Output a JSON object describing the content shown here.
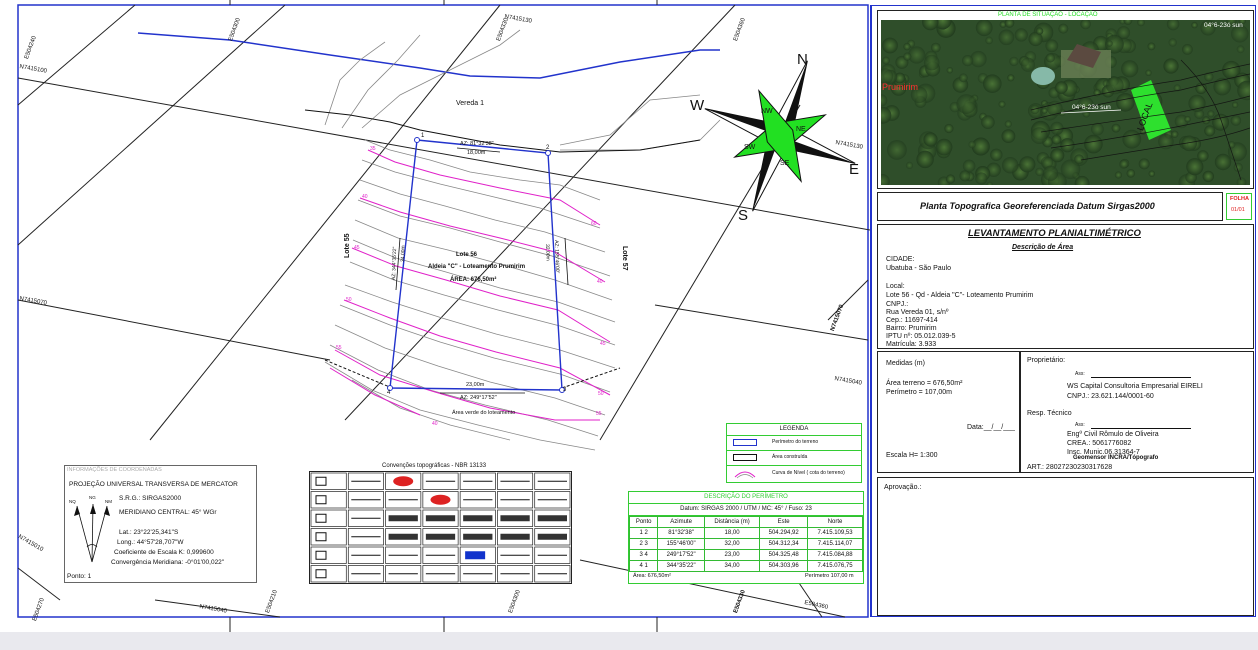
{
  "map": {
    "street_label": "Vereda 1",
    "lot_left": "Lote 55",
    "lot_right": "Lote 57",
    "lot_title": "Lote  56",
    "lot_subtitle": "Aldeia \"C\" - Loteamento Prumirim",
    "lot_area": "ÁREA: 676,50m²",
    "az_top": "AZ: 81°32'38\"",
    "dist_top": "18,00m",
    "dist_bottom": "23,00m",
    "az_bottom": "AZ: 249°17'52\"",
    "green_area_note": "Área verde do loteamento",
    "az_left": "AZ: 344°35'22\"",
    "dist_left": "34,00m",
    "az_right": "AZ: 155°46'00\"",
    "dist_right": "32,00m",
    "vertices": [
      "1",
      "2",
      "3",
      "4"
    ],
    "grid_labels": [
      "E504240",
      "E504270",
      "E504300",
      "E504330",
      "E504360",
      "N7415100",
      "N7415130",
      "N7415070",
      "N7415040",
      "N7415010",
      "E504210",
      "E504300",
      "E504330",
      "E504360",
      "N7415040",
      "N7415070",
      "N7415130",
      "N7415100"
    ],
    "contour_labels": [
      "35",
      "40",
      "45",
      "50",
      "55",
      "60",
      "40",
      "45",
      "50",
      "55",
      "40"
    ]
  },
  "compass": {
    "n": "N",
    "s": "S",
    "e": "E",
    "w": "W",
    "nw": "NW",
    "ne": "NE",
    "sw": "SW",
    "se": "SE"
  },
  "coords": {
    "header": "INFORMAÇÕES DE COORDENADAS",
    "projection": "PROJEÇÃO UNIVERSAL TRANSVERSA DE MERCATOR",
    "srg": "S.R.G.: SIRGAS2000",
    "meridian": "MERIDIANO CENTRAL: 45° WGr",
    "lat": "Lat.: 23°22'25,341\"S",
    "long": "Long.: 44°57'28,707\"W",
    "scale_k": "Coeficiente de Escala K: 0,999600",
    "convergence": "Convergência Meridiana: -0°01'00,022\"",
    "point": "Ponto: 1",
    "arrows": [
      "NQ",
      "NG",
      "NM"
    ]
  },
  "conventions": {
    "title": "Convenções topográficas - NBR 13133"
  },
  "legend": {
    "title": "LEGENDA",
    "items": [
      "Perímetro do terreno",
      "Área construída",
      "Curva de Nível ( cota do terreno)"
    ]
  },
  "perimeter": {
    "title": "DESCRIÇÃO DO PERÍMETRO",
    "datum": "Datum: SIRGAS 2000 / UTM / MC: 45° / Fuso: 23",
    "headers": [
      "Ponto",
      "Azimute",
      "Distância (m)",
      "Este",
      "Norte"
    ],
    "rows": [
      [
        "1 2",
        "81°32'38\"",
        "18,00",
        "504.294,92",
        "7.415.109,53"
      ],
      [
        "2 3",
        "155°46'00\"",
        "32,00",
        "504.312,34",
        "7.415.114,07"
      ],
      [
        "3 4",
        "249°17'52\"",
        "23,00",
        "504.325,48",
        "7.415.084,88"
      ],
      [
        "4 1",
        "344°35'22\"",
        "34,00",
        "504.303,96",
        "7.415.076,75"
      ]
    ],
    "area": "Área: 676,50m²",
    "perimeter_total": "Perímetro 107,00 m"
  },
  "situation": {
    "title": "PLANTA DE SITUAÇÃO - LOCAÇÃO",
    "label_top": "04°6-23ó sun",
    "label_mid": "04°6-23ó sun",
    "local": "LOCAL",
    "red_text": "Prumirim"
  },
  "title_block": {
    "plan_title": "Planta Topografica Georeferenciada Datum Sirgas2000",
    "folha_label": "FOLHA",
    "folha_value": "01/01",
    "survey_title": "LEVANTAMENTO PLANIALTIMÉTRICO",
    "area_desc": "Descrição de Área",
    "city_label": "CIDADE:",
    "city_value": "Ubatuba - São Paulo",
    "local_label": "Local:",
    "local_lines": [
      "Lote 56 - Qd - Aldeia \"C\"- Loteamento Prumirim",
      "CNPJ.:",
      "Rua Vereda 01, s/nº",
      "Cep.: 11697-414",
      "Bairro: Prumirim",
      "IPTU nº: 05.012.039-5",
      "Matrícula:  3.933"
    ],
    "medidas_label": "Medidas (m)",
    "area_terreno": "Área terreno =  676,50m²",
    "perimetro": "Perímetro =  107,00m",
    "data_label": "Data:__/__/___",
    "escala": "Escala H= 1:300",
    "proprietario_label": "Proprietário:",
    "ass1": "Ass:",
    "owner_name": "WS Capital Consultoria Empresarial EIRELI",
    "owner_cnpj": "CNPJ.:  23.621.144/0001-60",
    "resp_label": "Resp. Técnico",
    "ass2": "Ass:",
    "eng_name": "Engº Civil Rômulo de Oliveira",
    "crea": "CREA.:  5061776082",
    "insc": "Insc. Munic.06.31364-7",
    "geomensor": "Geomensor  INCRA/Tópografo",
    "art": "ART.: 28027230230317628",
    "aprovacao": "Aprovação.:"
  }
}
